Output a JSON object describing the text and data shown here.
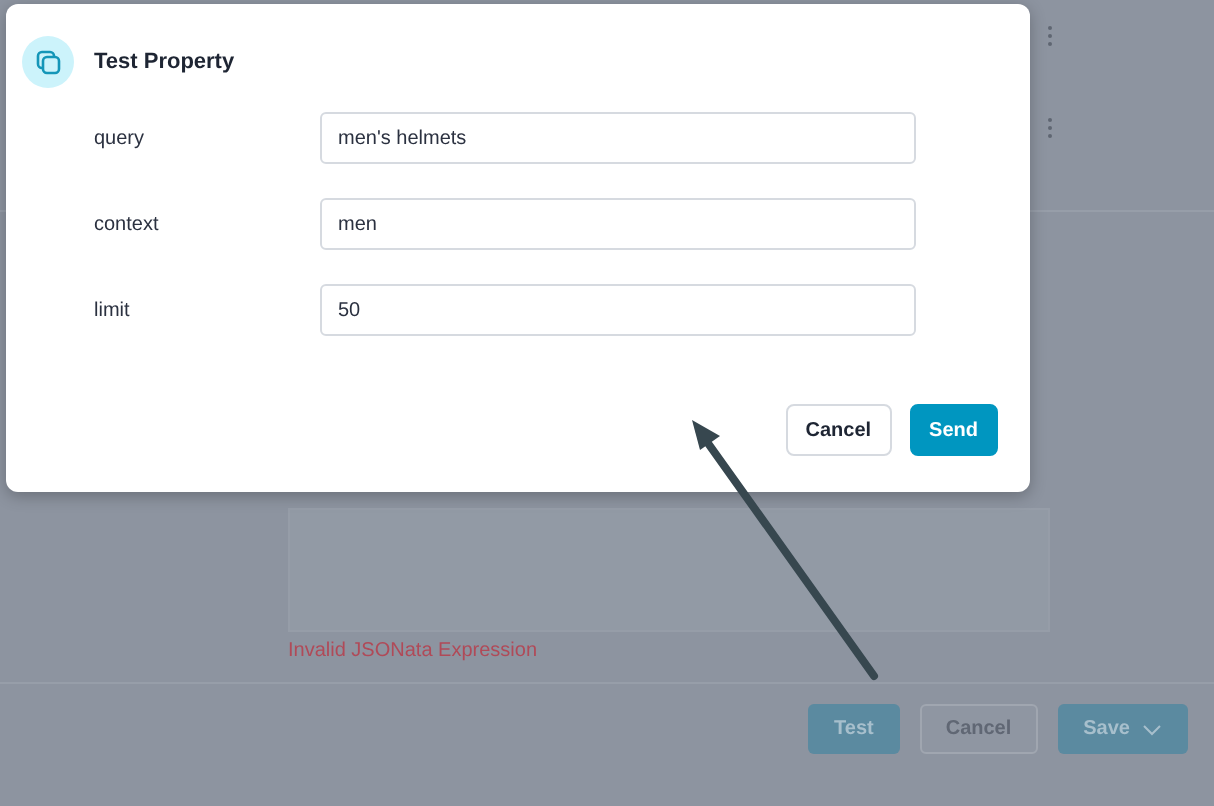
{
  "dialog": {
    "title": "Test Property",
    "fields": [
      {
        "label": "query",
        "value": "men's helmets"
      },
      {
        "label": "context",
        "value": "men"
      },
      {
        "label": "limit",
        "value": "50"
      }
    ],
    "buttons": [
      {
        "label": "Cancel",
        "kind": "secondary"
      },
      {
        "label": "Send",
        "kind": "primary"
      }
    ]
  },
  "background": {
    "error": "Invalid JSONata Expression",
    "buttons": [
      {
        "label": "Test",
        "kind": "primary"
      },
      {
        "label": "Cancel",
        "kind": "secondary"
      },
      {
        "label": "Save",
        "kind": "split"
      }
    ]
  }
}
